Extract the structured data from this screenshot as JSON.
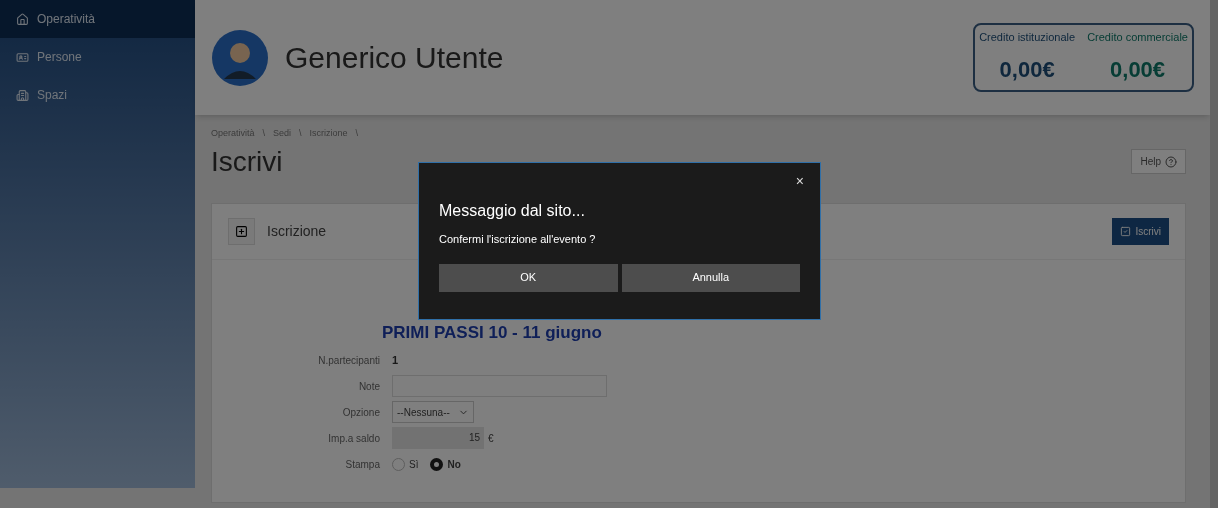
{
  "sidebar": {
    "items": [
      {
        "label": "Operatività",
        "selected": true
      },
      {
        "label": "Persone",
        "selected": false
      },
      {
        "label": "Spazi",
        "selected": false
      }
    ]
  },
  "header": {
    "user_name": "Generico Utente",
    "credits": [
      {
        "label": "Credito istituzionale",
        "value": "0,00€"
      },
      {
        "label": "Credito commerciale",
        "value": "0,00€"
      }
    ]
  },
  "breadcrumb": {
    "items": [
      "Operatività",
      "Sedi",
      "Iscrizione"
    ],
    "separator": "\\"
  },
  "page_title": "Iscrivi",
  "help_button": "Help",
  "panel": {
    "title": "Iscrizione",
    "submit_button": "Iscrivi",
    "event_title": "PRIMI PASSI 10 - 11 giugno",
    "fields": [
      {
        "kind": "text",
        "label": "N.partecipanti",
        "value": "1"
      },
      {
        "kind": "input",
        "label": "Note"
      },
      {
        "kind": "select",
        "label": "Opzione",
        "value": "--Nessuna--"
      },
      {
        "kind": "amount",
        "label": "Imp.a saldo",
        "value": "15",
        "unit": "€"
      },
      {
        "kind": "radio",
        "label": "Stampa",
        "options": [
          {
            "label": "Sì",
            "selected": false
          },
          {
            "label": "No",
            "selected": true
          }
        ]
      }
    ]
  },
  "dialog": {
    "title": "Messaggio dal sito...",
    "message": "Confermi l'iscrizione all'evento ?",
    "close": "×",
    "buttons": [
      "OK",
      "Annulla"
    ]
  }
}
